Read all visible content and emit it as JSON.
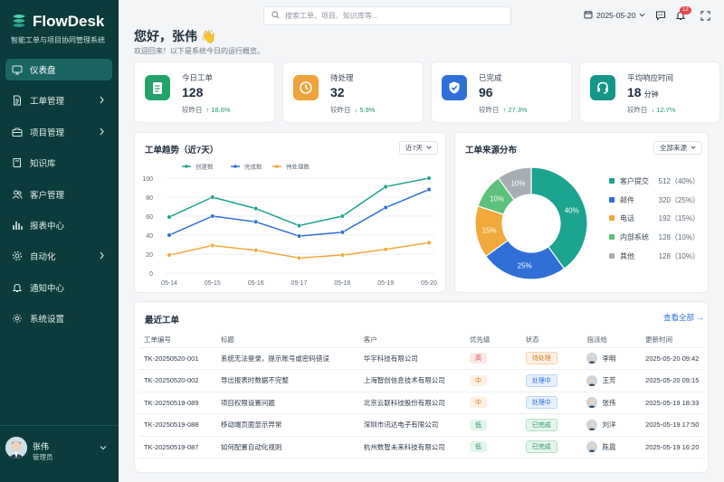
{
  "brand": {
    "name": "FlowDesk",
    "subtitle": "智能工单与项目协同管理系统"
  },
  "nav": [
    {
      "label": "仪表盘",
      "icon": "monitor-icon",
      "active": true,
      "chevron": false
    },
    {
      "label": "工单管理",
      "icon": "document-icon",
      "active": false,
      "chevron": true
    },
    {
      "label": "项目管理",
      "icon": "briefcase-icon",
      "active": false,
      "chevron": true
    },
    {
      "label": "知识库",
      "icon": "book-icon",
      "active": false,
      "chevron": false
    },
    {
      "label": "客户管理",
      "icon": "users-icon",
      "active": false,
      "chevron": false
    },
    {
      "label": "报表中心",
      "icon": "bar-chart-icon",
      "active": false,
      "chevron": false
    },
    {
      "label": "自动化",
      "icon": "gear-icon",
      "active": false,
      "chevron": true
    },
    {
      "label": "通知中心",
      "icon": "bell-icon",
      "active": false,
      "chevron": false
    },
    {
      "label": "系统设置",
      "icon": "settings-icon",
      "active": false,
      "chevron": false
    }
  ],
  "user": {
    "name": "张伟",
    "role": "管理员"
  },
  "topbar": {
    "search_placeholder": "搜索工单、项目、知识库等...",
    "date": "2025-05-20",
    "notif_count": "12"
  },
  "greeting": {
    "title": "您好，张伟 👋",
    "subtitle": "欢迎回来！以下是系统今日的运行概览。"
  },
  "stats": [
    {
      "label": "今日工单",
      "value": "128",
      "unit": "",
      "compare": "较昨日",
      "delta": "↑ 18.6%",
      "color": "#22a36b",
      "icon": "clipboard-icon"
    },
    {
      "label": "待处理",
      "value": "32",
      "unit": "",
      "compare": "较昨日",
      "delta": "↓ 5.9%",
      "color": "#f0a33a",
      "icon": "clock-icon"
    },
    {
      "label": "已完成",
      "value": "96",
      "unit": "",
      "compare": "较昨日",
      "delta": "↑ 27.3%",
      "color": "#2f6fd6",
      "icon": "check-icon"
    },
    {
      "label": "平均响应时间",
      "value": "18",
      "unit": "分钟",
      "compare": "较昨日",
      "delta": "↓ 12.7%",
      "color": "#14968a",
      "icon": "headset-icon"
    }
  ],
  "trend": {
    "title": "工单趋势（近7天）",
    "range": "近7天"
  },
  "source": {
    "title": "工单来源分布",
    "filter": "全部来源"
  },
  "chart_data": [
    {
      "type": "line",
      "title": "工单趋势（近7天）",
      "categories": [
        "05-14",
        "05-15",
        "05-16",
        "05-17",
        "05-18",
        "05-19",
        "05-20"
      ],
      "series": [
        {
          "name": "创建数",
          "color": "#1ba48f",
          "values": [
            59,
            80,
            68,
            50,
            60,
            91,
            100
          ]
        },
        {
          "name": "完成数",
          "color": "#2f6fd6",
          "values": [
            40,
            60,
            54,
            39,
            43,
            69,
            88
          ]
        },
        {
          "name": "待处理数",
          "color": "#f0a93a",
          "values": [
            19,
            29,
            24,
            16,
            19,
            25,
            32
          ]
        }
      ],
      "yticks": [
        0,
        20,
        40,
        60,
        80,
        100
      ],
      "ylim": [
        0,
        100
      ],
      "grid": true,
      "legend": "top"
    },
    {
      "type": "pie",
      "title": "工单来源分布",
      "slices": [
        {
          "name": "客户提交",
          "value": 512,
          "pct": "40%",
          "color": "#1ba48f"
        },
        {
          "name": "邮件",
          "value": 320,
          "pct": "25%",
          "color": "#2f6fd6"
        },
        {
          "name": "电话",
          "value": 192,
          "pct": "15%",
          "color": "#f0a93a"
        },
        {
          "name": "内部系统",
          "value": 128,
          "pct": "10%",
          "color": "#5cc17a"
        },
        {
          "name": "其他",
          "value": 128,
          "pct": "10%",
          "color": "#a7adb5"
        }
      ],
      "legend": "right"
    }
  ],
  "source_legend": [
    {
      "name": "客户提交",
      "val": "512（40%）",
      "color": "#1ba48f"
    },
    {
      "name": "邮件",
      "val": "320（25%）",
      "color": "#2f6fd6"
    },
    {
      "name": "电话",
      "val": "192（15%）",
      "color": "#f0a93a"
    },
    {
      "name": "内部系统",
      "val": "128（10%）",
      "color": "#5cc17a"
    },
    {
      "name": "其他",
      "val": "128（10%）",
      "color": "#a7adb5"
    }
  ],
  "recent": {
    "title": "最近工单",
    "view_all": "查看全部 →",
    "columns": [
      "工单编号",
      "标题",
      "客户",
      "优先级",
      "状态",
      "指派给",
      "更新时间"
    ],
    "rows": [
      {
        "id": "TK-20250520-001",
        "title": "系统无法登录，提示账号或密码错误",
        "customer": "华宇科技有限公司",
        "priority": "高",
        "pcls": "p-high",
        "status": "待处理",
        "scls": "s-wait",
        "assignee": "李明",
        "time": "2025-05-20 09:42"
      },
      {
        "id": "TK-20250520-002",
        "title": "导出报表时数据不完整",
        "customer": "上海智创信息技术有限公司",
        "priority": "中",
        "pcls": "p-mid",
        "status": "处理中",
        "scls": "s-doing",
        "assignee": "王芳",
        "time": "2025-05-20 09:15"
      },
      {
        "id": "TK-20250519-089",
        "title": "项目权限设置问题",
        "customer": "北京云联科技股份有限公司",
        "priority": "中",
        "pcls": "p-mid",
        "status": "处理中",
        "scls": "s-doing",
        "assignee": "张伟",
        "time": "2025-05-19 18:33"
      },
      {
        "id": "TK-20250519-088",
        "title": "移动端页面显示异常",
        "customer": "深圳市讯达电子有限公司",
        "priority": "低",
        "pcls": "p-low",
        "status": "已完成",
        "scls": "s-done",
        "assignee": "刘洋",
        "time": "2025-05-19 17:50"
      },
      {
        "id": "TK-20250519-087",
        "title": "如何配置自动化规则",
        "customer": "杭州数智未来科技有限公司",
        "priority": "低",
        "pcls": "p-low",
        "status": "已完成",
        "scls": "s-done",
        "assignee": "陈晨",
        "time": "2025-05-19 16:20"
      }
    ]
  }
}
